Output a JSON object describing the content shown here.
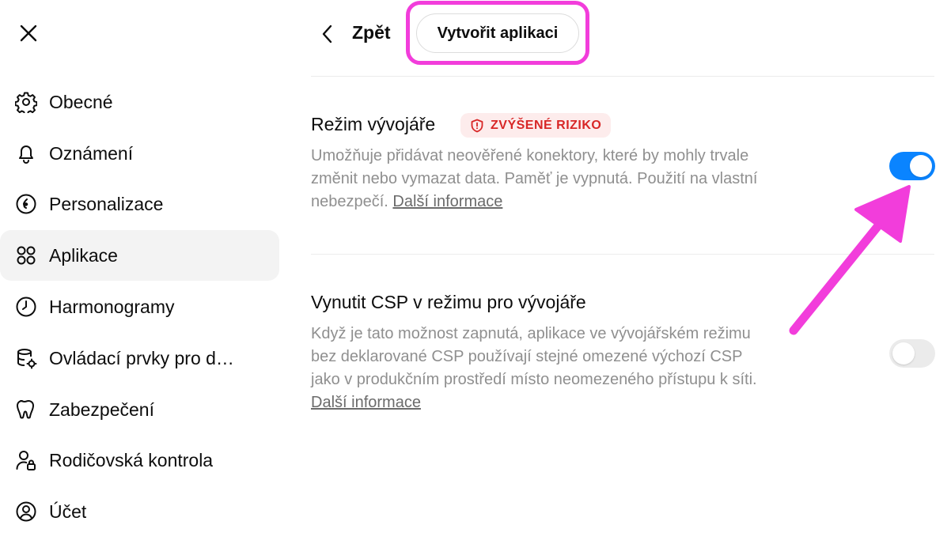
{
  "sidebar": {
    "close_icon": "close-icon",
    "items": [
      {
        "label": "Obecné",
        "icon": "gear-icon"
      },
      {
        "label": "Oznámení",
        "icon": "bell-icon"
      },
      {
        "label": "Personalizace",
        "icon": "personalization-icon"
      },
      {
        "label": "Aplikace",
        "icon": "apps-grid-icon",
        "active": true
      },
      {
        "label": "Harmonogramy",
        "icon": "clock-icon"
      },
      {
        "label": "Ovládací prvky pro d…",
        "icon": "database-gear-icon"
      },
      {
        "label": "Zabezpečení",
        "icon": "security-icon"
      },
      {
        "label": "Rodičovská kontrola",
        "icon": "parental-control-icon"
      },
      {
        "label": "Účet",
        "icon": "account-icon"
      }
    ]
  },
  "header": {
    "back_label": "Zpět",
    "create_app_label": "Vytvořit aplikaci"
  },
  "settings": {
    "developer_mode": {
      "title": "Režim vývojáře",
      "badge": "ZVÝŠENÉ RIZIKO",
      "description": "Umožňuje přidávat neověřené konektory, které by mohly trvale změnit nebo vymazat data. Paměť je vypnutá. Použití na vlastní nebezpečí.",
      "link": "Další informace",
      "enabled": true
    },
    "enforce_csp": {
      "title": "Vynutit CSP v režimu pro vývojáře",
      "description": "Když je tato možnost zapnutá, aplikace ve vývojářském režimu bez deklarované CSP používají stejné omezené výchozí CSP jako v produkčním prostředí místo neomezeného přístupu k síti.",
      "link": "Další informace",
      "enabled": false
    }
  },
  "colors": {
    "accent": "#0a84ff",
    "highlight": "#f23ddb",
    "risk": "#d82626",
    "risk_bg": "#fdecec",
    "active_bg": "#f3f3f3"
  }
}
